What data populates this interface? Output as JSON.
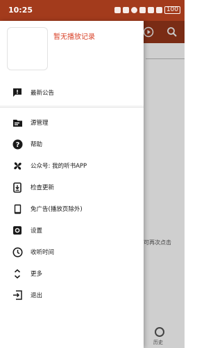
{
  "status_bar": {
    "time": "10:25",
    "battery": "100"
  },
  "drawer": {
    "header_title": "暂无播放记录",
    "items": [
      {
        "label": "最新公告",
        "icon": "announcement-icon"
      },
      {
        "label": "源管理",
        "icon": "folder-icon"
      },
      {
        "label": "帮助",
        "icon": "help-icon"
      },
      {
        "label": "公众号: 我的听书APP",
        "icon": "pinwheel-icon"
      },
      {
        "label": "检查更新",
        "icon": "download-update-icon"
      },
      {
        "label": "免广告(播放页除外)",
        "icon": "phone-icon"
      },
      {
        "label": "设置",
        "icon": "settings-icon"
      },
      {
        "label": "收听时间",
        "icon": "timer-icon"
      },
      {
        "label": "更多",
        "icon": "expand-icon"
      },
      {
        "label": "退出",
        "icon": "exit-icon"
      }
    ]
  },
  "background": {
    "hint_text": "可再次点击",
    "bottom_tab_label": "历史"
  },
  "colors": {
    "status_bar": "#a33b1c",
    "accent_text": "#d9432a",
    "dim_background": "#cfcfcf"
  }
}
